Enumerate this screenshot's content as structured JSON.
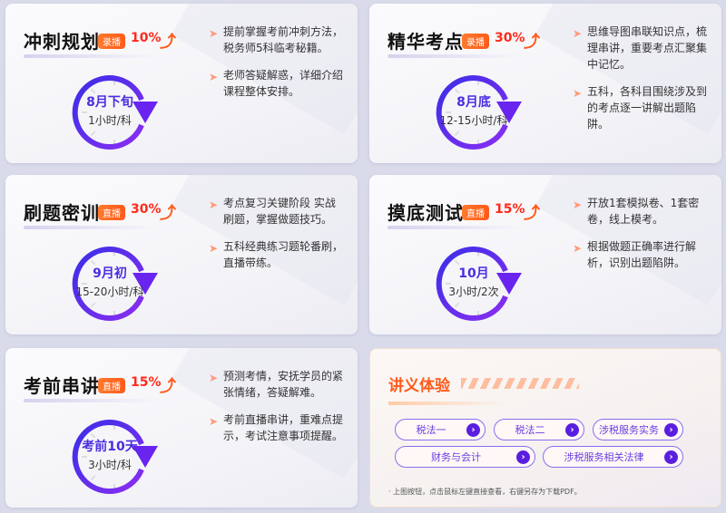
{
  "cards": [
    {
      "title": "冲刺规划",
      "badge": "录播",
      "percent": "10%",
      "time": "8月下旬",
      "duration": "1小时/科",
      "bullets": [
        "提前掌握考前冲刺方法，税务师5科临考秘籍。",
        "老师答疑解惑，详细介绍课程整体安排。"
      ]
    },
    {
      "title": "精华考点",
      "badge": "录播",
      "percent": "30%",
      "time": "8月底",
      "duration": "12-15小时/科",
      "bullets": [
        "思维导图串联知识点，梳理串讲，重要考点汇聚集中记忆。",
        "五科，各科目围绕涉及到的考点逐一讲解出题陷阱。"
      ]
    },
    {
      "title": "刷题密训",
      "badge": "直播",
      "percent": "30%",
      "time": "9月初",
      "duration": "15-20小时/科",
      "bullets": [
        "考点复习关键阶段 实战刷题，掌握做题技巧。",
        "五科经典练习题轮番刷，直播带练。"
      ]
    },
    {
      "title": "摸底测试",
      "badge": "直播",
      "percent": "15%",
      "time": "10月",
      "duration": "3小时/2次",
      "bullets": [
        "开放1套模拟卷、1套密卷，线上模考。",
        "根据做题正确率进行解析，识别出题陷阱。"
      ]
    },
    {
      "title": "考前串讲",
      "badge": "直播",
      "percent": "15%",
      "time": "考前10天",
      "duration": "3小时/科",
      "bullets": [
        "预测考情，安抚学员的紧张情绪，答疑解难。",
        "考前直播串讲，重难点提示，考试注意事项提醒。"
      ]
    }
  ],
  "handout": {
    "title": "讲义体验",
    "buttons": [
      "税法一",
      "税法二",
      "涉税服务实务",
      "财务与会计",
      "涉税服务相关法律"
    ],
    "note": "· 上图按钮，点击鼠标左键直接查看，右键另存为下载PDF。"
  },
  "colors": {
    "accent": "#5a1ee0",
    "orange": "#ff5a1a"
  }
}
